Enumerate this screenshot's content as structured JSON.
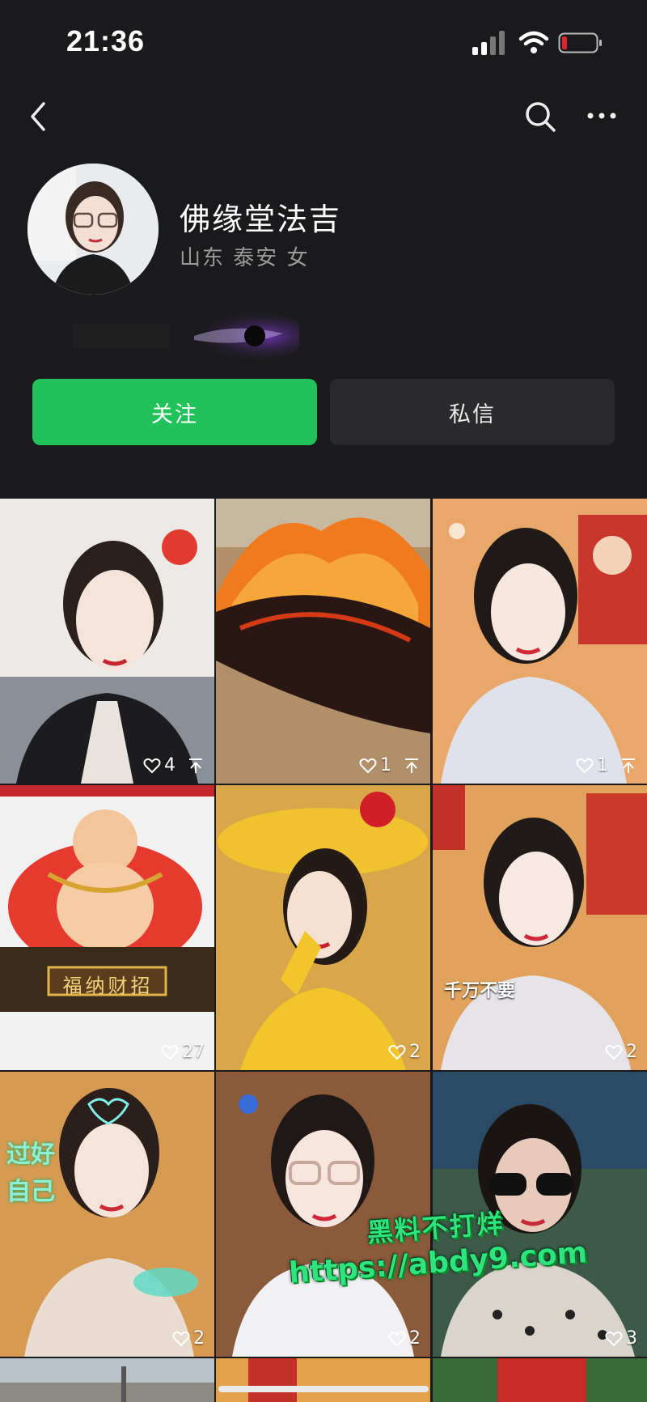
{
  "status": {
    "time": "21:36"
  },
  "profile": {
    "name": "佛缘堂法吉",
    "location": "山东 泰安",
    "gender": "女"
  },
  "actions": {
    "follow": "关注",
    "message": "私信"
  },
  "posts": [
    {
      "likes": "4",
      "pinned": true
    },
    {
      "likes": "1",
      "pinned": true
    },
    {
      "likes": "1",
      "pinned": true
    },
    {
      "likes": "27",
      "pinned": false
    },
    {
      "likes": "2",
      "pinned": false
    },
    {
      "likes": "2",
      "pinned": false,
      "caption": "千万不要"
    },
    {
      "likes": "2",
      "pinned": false,
      "caption": "过好自己"
    },
    {
      "likes": "2",
      "pinned": false
    },
    {
      "likes": "3",
      "pinned": false
    }
  ],
  "banner_text": "福纳财招",
  "watermark": {
    "line1": "黑料不打烊",
    "line2": "https://abdy9.com"
  },
  "colors": {
    "accent": "#21c25a",
    "background": "#1a1a1c",
    "watermark": "#2fe37f"
  },
  "icons": [
    "back-icon",
    "search-icon",
    "more-icon",
    "heart-icon",
    "pin-icon"
  ]
}
